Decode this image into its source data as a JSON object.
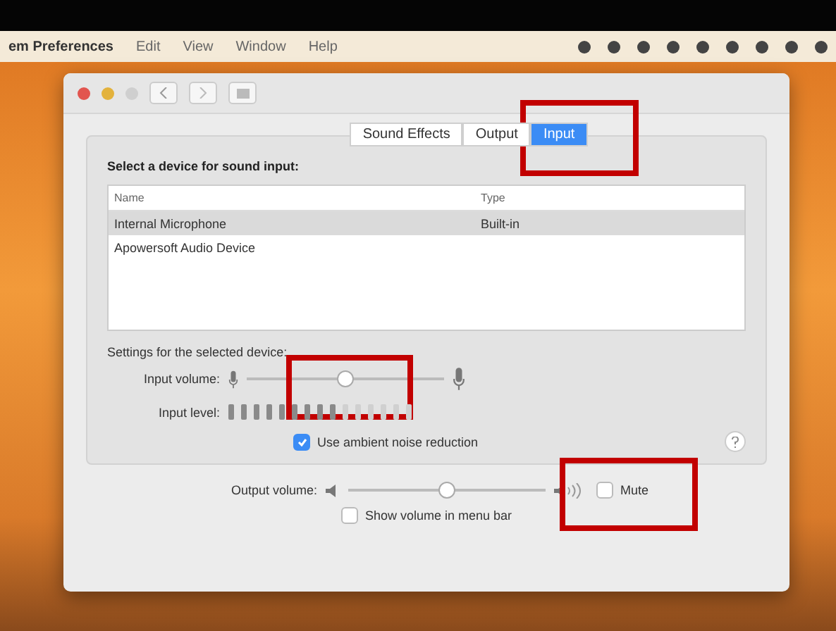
{
  "menu_bar": {
    "items": [
      "em Preferences",
      "Edit",
      "View",
      "Window",
      "Help"
    ]
  },
  "window": {
    "tabs": [
      {
        "label": "Sound Effects",
        "selected": false,
        "highlighted": false
      },
      {
        "label": "Output",
        "selected": false,
        "highlighted": false
      },
      {
        "label": "Input",
        "selected": true,
        "highlighted": true
      }
    ],
    "device_prompt": "Select a device for sound input:",
    "table": {
      "columns": [
        "Name",
        "Type"
      ],
      "rows": [
        {
          "name": "Internal Microphone",
          "type": "Built-in",
          "selected": true
        },
        {
          "name": "Apowersoft Audio Device",
          "selected": false
        }
      ]
    },
    "settings_heading": "Settings for the selected device:",
    "input_volume": {
      "label": "Input volume:",
      "level": 0.5,
      "highlighted": true
    },
    "input_level": {
      "label": "Input level:",
      "level": 0.6
    },
    "noise_reduction": {
      "label": "Use ambient noise reduction",
      "checked": true
    },
    "output_volume": {
      "label": "Output volume:",
      "level": 0.5
    },
    "mute": {
      "label": "Mute",
      "checked": false,
      "highlighted": true
    },
    "show_volume": {
      "label": "Show volume in menu bar",
      "checked": false
    }
  }
}
